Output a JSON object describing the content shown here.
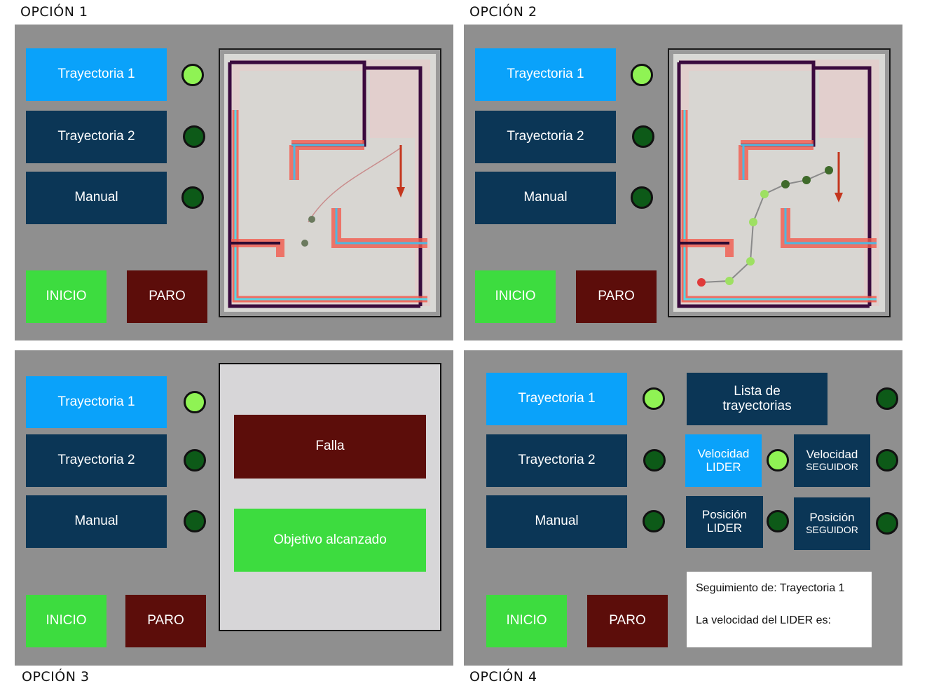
{
  "options": [
    {
      "title": "OPCIÓN 1"
    },
    {
      "title": "OPCIÓN 2"
    },
    {
      "title": "OPCIÓN 3"
    },
    {
      "title": "OPCIÓN 4"
    }
  ],
  "buttons": {
    "trayectoria_1": "Trayectoria 1",
    "trayectoria_2": "Trayectoria 2",
    "manual": "Manual",
    "inicio": "INICIO",
    "paro": "PARO"
  },
  "option3": {
    "falla": "Falla",
    "objetivo": "Objetivo alcanzado"
  },
  "option4": {
    "lista_line1": "Lista de",
    "lista_line2": "trayectorias",
    "vel_lider_line1": "Velocidad",
    "vel_lider_line2": "LIDER",
    "vel_seguidor_line1": "Velocidad",
    "vel_seguidor_line2": "SEGUIDOR",
    "pos_lider_line1": "Posición",
    "pos_lider_line2": "LIDER",
    "pos_seguidor_line1": "Posición",
    "pos_seguidor_line2": "SEGUIDOR",
    "info_line1": "Seguimiento de: Trayectoria 1",
    "info_line2": "La velocidad del LIDER es:"
  },
  "colors": {
    "panel": "#8f8f8f",
    "light_blue": "#0aa2fa",
    "dark_blue": "#0b3656",
    "green": "#3ddc3f",
    "maroon": "#5c0d0a",
    "led_on": "#8ff354",
    "led_off": "#0d5a18"
  }
}
